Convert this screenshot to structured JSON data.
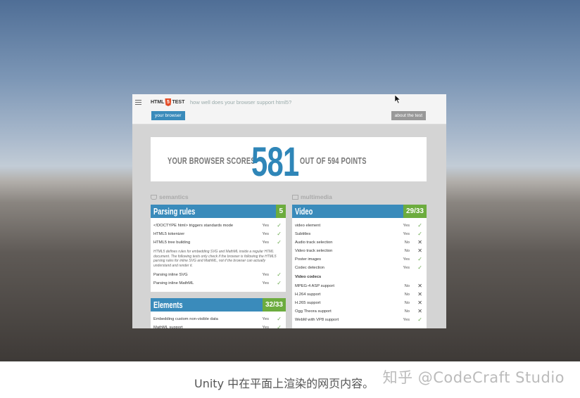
{
  "browser": {
    "logo_left": "HTML",
    "logo_badge": "5",
    "logo_right": "TEST",
    "tagline": "how well does your browser support html5?",
    "btn_your_browser": "your browser",
    "btn_about": "about the test"
  },
  "score": {
    "prefix": "YOUR BROWSER SCORES",
    "value": "581",
    "suffix": "OUT OF 594 POINTS"
  },
  "sections": {
    "left_label": "semantics",
    "right_label": "multimedia"
  },
  "parsing": {
    "title": "Parsing rules",
    "score": "5",
    "rows": [
      {
        "label": "<!DOCTYPE html> triggers standards mode",
        "result": "Yes",
        "ok": true
      },
      {
        "label": "HTML5 tokenizer",
        "result": "Yes",
        "ok": true
      },
      {
        "label": "HTML5 tree building",
        "result": "Yes",
        "ok": true
      }
    ],
    "note": "HTML5 defines rules for embedding SVG and MathML inside a regular HTML document. The following tests only check if the browser is following the HTML5 parsing rules for inline SVG and MathML, not if the browser can actually understand and render it.",
    "rows2": [
      {
        "label": "Parsing inline SVG",
        "result": "Yes",
        "ok": true
      },
      {
        "label": "Parsing inline MathML",
        "result": "Yes",
        "ok": true
      }
    ]
  },
  "elements": {
    "title": "Elements",
    "score": "32/33",
    "rows": [
      {
        "label": "Embedding custom non-visible data",
        "result": "Yes",
        "ok": true
      },
      {
        "label": "MathML support",
        "result": "Yes",
        "ok": true
      }
    ]
  },
  "video": {
    "title": "Video",
    "score": "29/33",
    "rows": [
      {
        "label": "video element",
        "result": "Yes",
        "ok": true
      },
      {
        "label": "Subtitles",
        "result": "Yes",
        "ok": true
      },
      {
        "label": "Audio track selection",
        "result": "No",
        "ok": false
      },
      {
        "label": "Video track selection",
        "result": "No",
        "ok": false
      },
      {
        "label": "Poster images",
        "result": "Yes",
        "ok": true
      },
      {
        "label": "Codec detection",
        "result": "Yes",
        "ok": true
      }
    ],
    "codecs_heading": "Video codecs",
    "codecs": [
      {
        "label": "MPEG-4 ASP support",
        "result": "No",
        "ok": false
      },
      {
        "label": "H.264 support",
        "result": "No",
        "ok": false
      },
      {
        "label": "H.265 support",
        "result": "No",
        "ok": false
      },
      {
        "label": "Ogg Theora support",
        "result": "No",
        "ok": false
      },
      {
        "label": "WebM with VP8 support",
        "result": "Yes",
        "ok": true
      }
    ]
  },
  "caption": "Unity 中在平面上渲染的网页内容。",
  "watermark": "知乎 @CodeCraft Studio",
  "colors": {
    "accent": "#3a8bbb",
    "score_green": "#6cac3e",
    "score_blue": "#2f86b8"
  },
  "icons": {
    "check": "check-icon",
    "cross": "cross-icon",
    "menu": "hamburger-icon"
  }
}
